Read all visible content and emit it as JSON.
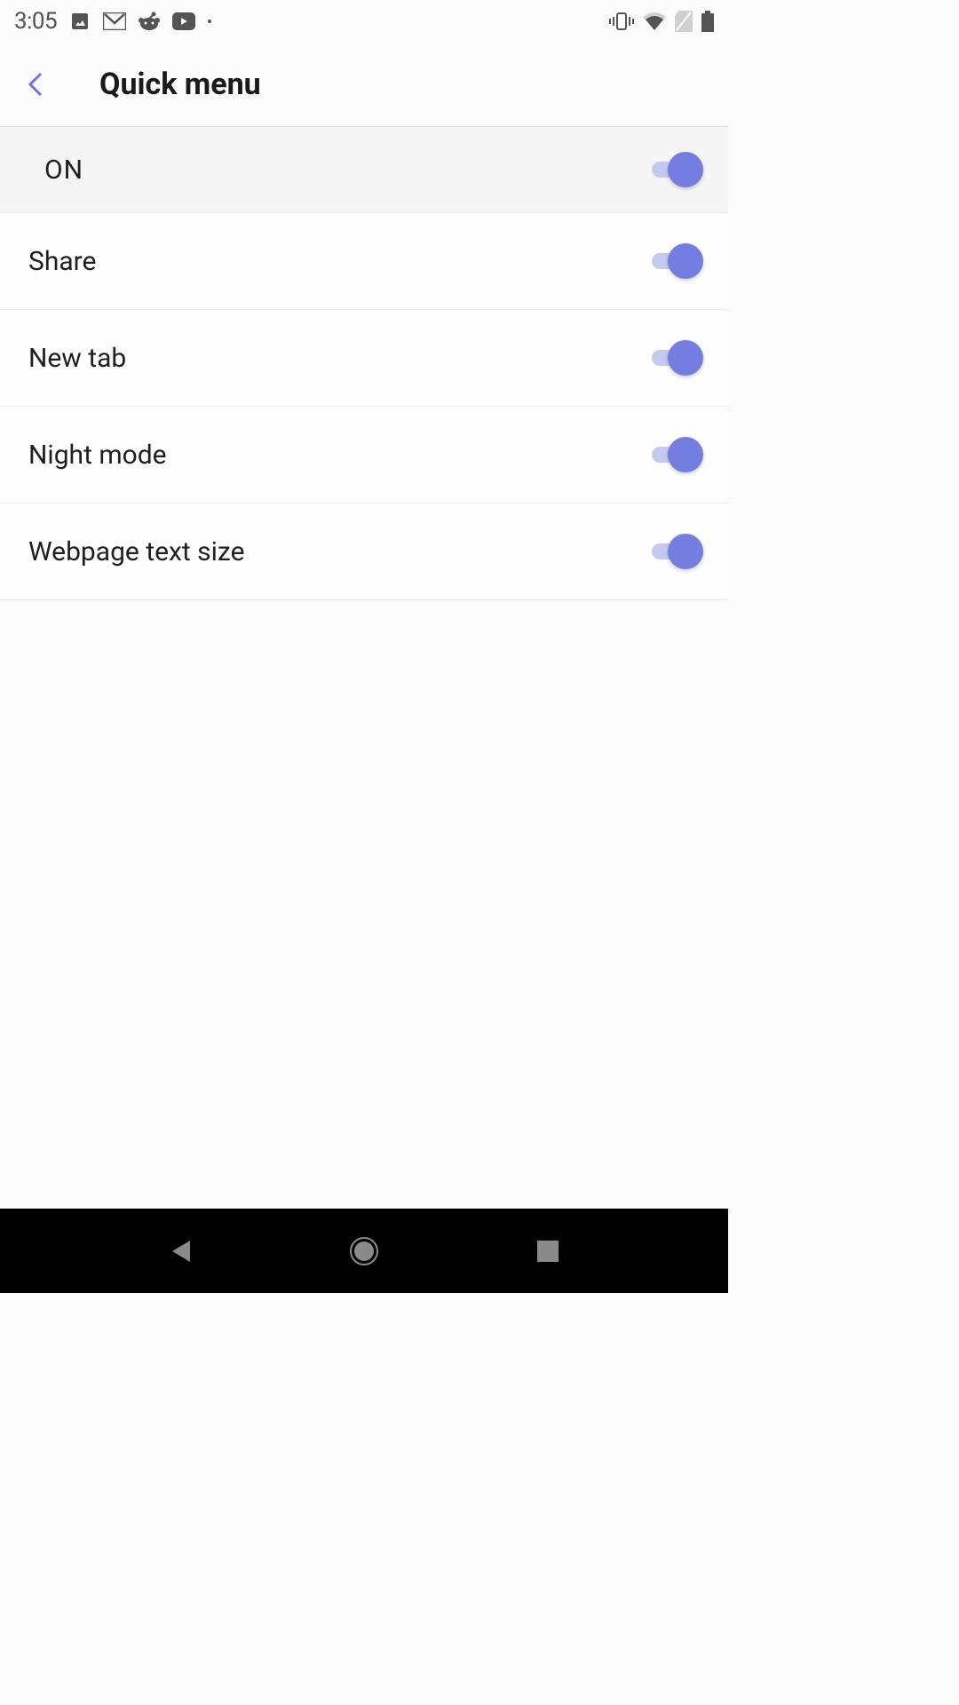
{
  "statusbar": {
    "time": "3:05"
  },
  "header": {
    "title": "Quick menu"
  },
  "items": [
    {
      "label": "ON",
      "on": true
    },
    {
      "label": "Share",
      "on": true
    },
    {
      "label": "New tab",
      "on": true
    },
    {
      "label": "Night mode",
      "on": true
    },
    {
      "label": "Webpage text size",
      "on": true
    }
  ]
}
